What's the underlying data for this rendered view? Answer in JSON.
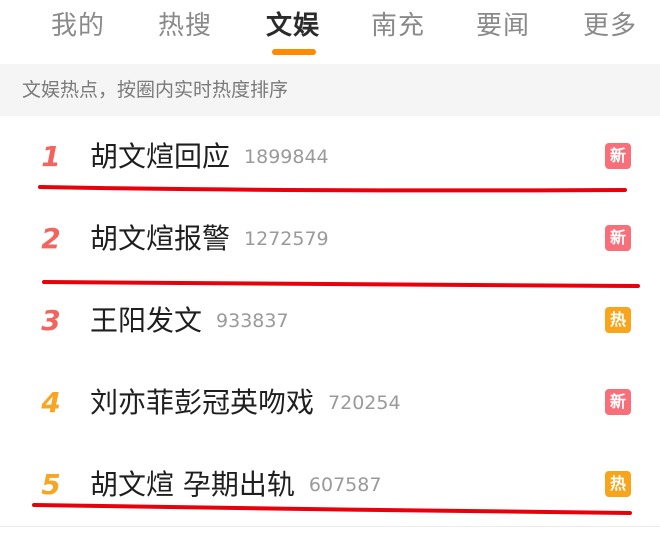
{
  "tabs": [
    {
      "label": "我的",
      "active": false
    },
    {
      "label": "热搜",
      "active": false
    },
    {
      "label": "文娱",
      "active": true
    },
    {
      "label": "南充",
      "active": false
    },
    {
      "label": "要闻",
      "active": false
    },
    {
      "label": "更多",
      "active": false
    }
  ],
  "subheader": "文娱热点，按圈内实时热度排序",
  "items": [
    {
      "rank": "1",
      "title": "胡文煊回应",
      "count": "1899844",
      "badge": "新",
      "badge_type": "new",
      "rank_color": "#f4645f"
    },
    {
      "rank": "2",
      "title": "胡文煊报警",
      "count": "1272579",
      "badge": "新",
      "badge_type": "new",
      "rank_color": "#f4645f"
    },
    {
      "rank": "3",
      "title": "王阳发文",
      "count": "933837",
      "badge": "热",
      "badge_type": "hot",
      "rank_color": "#f4645f"
    },
    {
      "rank": "4",
      "title": "刘亦菲彭冠英吻戏",
      "count": "720254",
      "badge": "新",
      "badge_type": "new",
      "rank_color": "#f6a623"
    },
    {
      "rank": "5",
      "title": "胡文煊 孕期出轨",
      "count": "607587",
      "badge": "热",
      "badge_type": "hot",
      "rank_color": "#f6a623"
    }
  ],
  "colors": {
    "accent": "#ff8a00",
    "badge_new": "#f86f7a",
    "badge_hot": "#f8a51c",
    "annotation_line": "#e8000b"
  }
}
